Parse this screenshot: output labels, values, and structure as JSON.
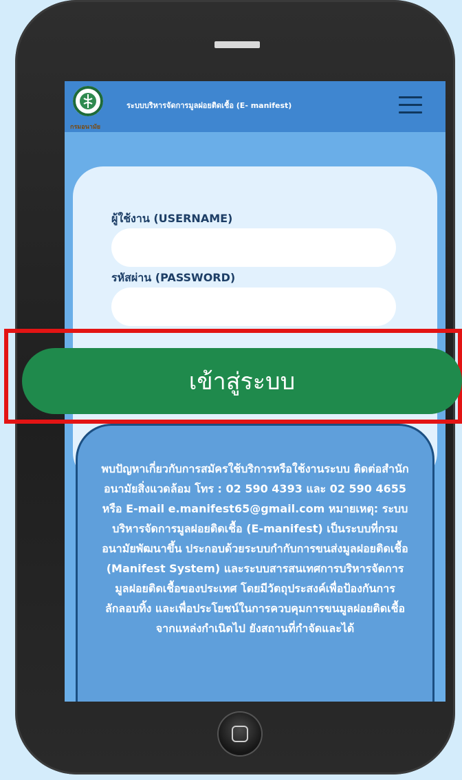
{
  "header": {
    "logo_text": "กรมอนามัย",
    "title": "ระบบบริหารจัดการมูลฝอยติดเชื้อ (E- manifest)",
    "menu_icon": "hamburger-menu-icon"
  },
  "login": {
    "username_label": "ผู้ใช้งาน (USERNAME)",
    "username_value": "",
    "password_label": "รหัสผ่าน (PASSWORD)",
    "password_value": "",
    "submit_label": "เข้าสู่ระบบ"
  },
  "info": {
    "text": "พบปัญหาเกี่ยวกับการสมัครใช้บริการหรือใช้งานระบบ ติดต่อสำนักอนามัยสิ่งแวดล้อม โทร : 02 590 4393 และ 02 590 4655 หรือ E-mail e.manifest65@gmail.com หมายเหตุ: ระบบบริหารจัดการมูลฝอยติดเชื้อ (E-manifest) เป็นระบบที่กรมอนามัยพัฒนาขึ้น ประกอบด้วยระบบกำกับการขนส่งมูลฝอยติดเชื้อ (Manifest System) และระบบสารสนเทศการบริหารจัดการมูลฝอยติดเชื้อของประเทศ โดยมีวัตถุประสงค์เพื่อป้องกันการลักลอบทิ้ง และเพื่อประโยชน์ในการควบคุมการขนมูลฝอยติดเชื้อจากแหล่งกำเนิดไป ยังสถานที่กำจัดและได้"
  },
  "colors": {
    "page_background": "#d4ecfb",
    "phone_body": "#242424",
    "screen_background": "#6aaee8",
    "header_background": "#3f86d0",
    "card_background": "#e2f1fd",
    "label_color": "#1d3e66",
    "button_green": "#1f8a4c",
    "highlight_red": "#e31414",
    "info_box_border": "#1b4f82"
  }
}
